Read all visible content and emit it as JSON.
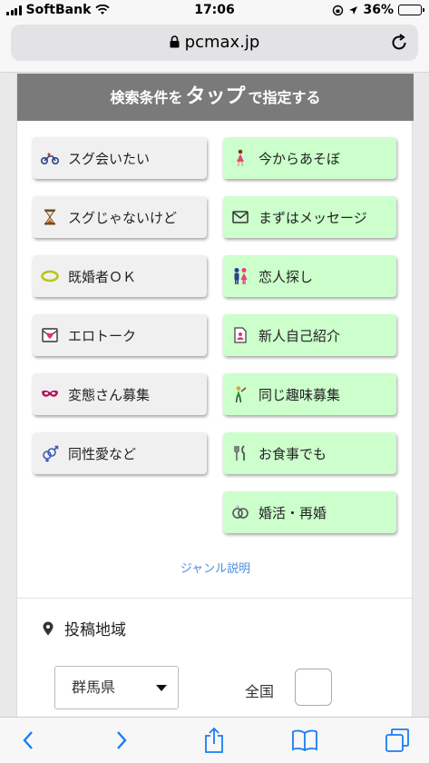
{
  "status_bar": {
    "carrier": "SoftBank",
    "time": "17:06",
    "battery": "36%"
  },
  "browser": {
    "url": "pcmax.jp"
  },
  "search": {
    "header_prefix": "検索条件を",
    "header_big": "タップ",
    "header_suffix": "で指定する",
    "left_buttons": [
      {
        "label": "スグ会いたい",
        "icon": "motorcycle-icon"
      },
      {
        "label": "スグじゃないけど",
        "icon": "hourglass-icon"
      },
      {
        "label": "既婚者ＯＫ",
        "icon": "ring-icon"
      },
      {
        "label": "エロトーク",
        "icon": "love-letter-icon"
      },
      {
        "label": "変態さん募集",
        "icon": "mask-icon"
      },
      {
        "label": "同性愛など",
        "icon": "gender-icon"
      }
    ],
    "right_buttons": [
      {
        "label": "今からあそぼ",
        "icon": "dancer-icon"
      },
      {
        "label": "まずはメッセージ",
        "icon": "envelope-icon"
      },
      {
        "label": "恋人探し",
        "icon": "couple-icon"
      },
      {
        "label": "新人自己紹介",
        "icon": "profile-card-icon"
      },
      {
        "label": "同じ趣味募集",
        "icon": "hobby-icon"
      },
      {
        "label": "お食事でも",
        "icon": "fork-knife-icon"
      },
      {
        "label": "婚活・再婚",
        "icon": "rings-icon"
      }
    ],
    "genre_link": "ジャンル説明"
  },
  "region": {
    "label": "投稿地域",
    "selected_prefecture": "群馬県",
    "nationwide_label": "全国",
    "nationwide_checked": false
  },
  "colors": {
    "header_bg": "#7a7a7a",
    "green_button": "#ccffcc",
    "gray_button": "#f0f0f0",
    "link": "#4a90d9"
  }
}
